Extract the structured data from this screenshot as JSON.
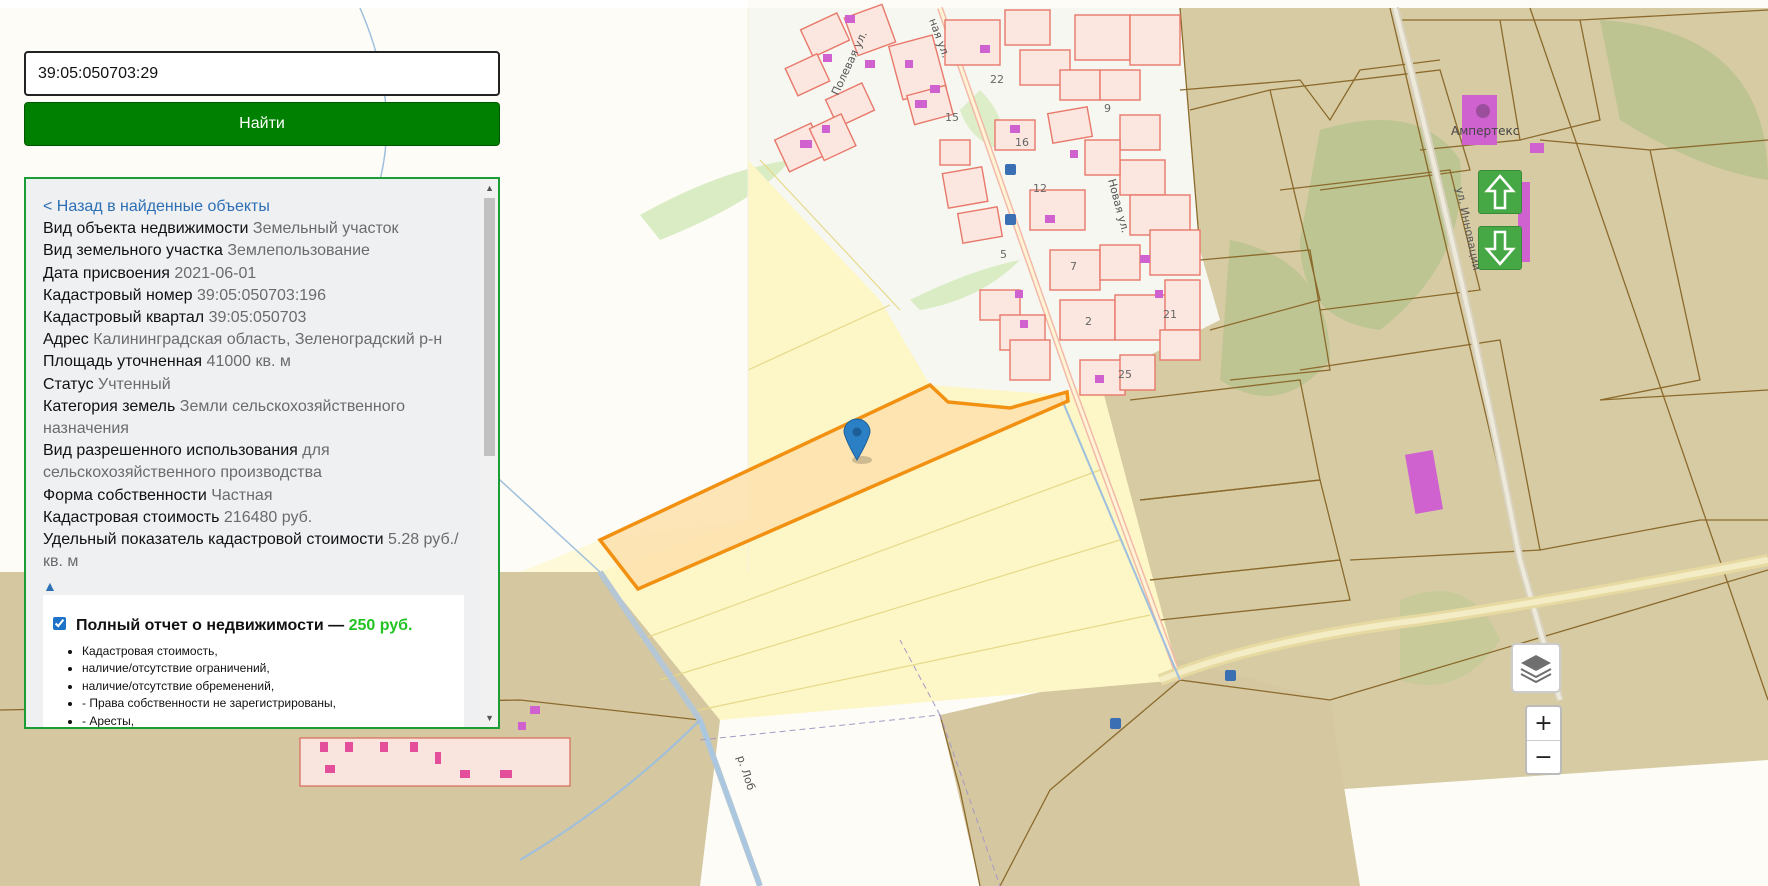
{
  "search": {
    "value": "39:05:050703:29",
    "button_label": "Найти"
  },
  "panel": {
    "back_link": "< Назад в найденные объекты",
    "fields": [
      {
        "label": "Вид объекта недвижимости",
        "value": "Земельный участок"
      },
      {
        "label": "Вид земельного участка",
        "value": "Землепользование"
      },
      {
        "label": "Дата присвоения",
        "value": "2021-06-01"
      },
      {
        "label": "Кадастровый номер",
        "value": "39:05:050703:196"
      },
      {
        "label": "Кадастровый квартал",
        "value": "39:05:050703"
      },
      {
        "label": "Адрес",
        "value": "Калининградская область, Зеленоградский р-н"
      },
      {
        "label": "Площадь уточненная",
        "value": "41000 кв. м"
      },
      {
        "label": "Статус",
        "value": "Учтенный"
      },
      {
        "label": "Категория земель",
        "value": "Земли сельскохозяйственного назначения"
      },
      {
        "label": "Вид разрешенного использования",
        "value": "для сельскохозяйственного производства"
      },
      {
        "label": "Форма собственности",
        "value": "Частная"
      },
      {
        "label": "Кадастровая стоимость",
        "value": "216480 руб."
      },
      {
        "label": "Удельный показатель кадастровой стоимости",
        "value": "5.28 руб./кв. м"
      }
    ],
    "collapse_symbol": "▲",
    "report": {
      "checked": true,
      "title": "Полный отчет о недвижимости —",
      "price": "250 руб.",
      "items": [
        "Кадастровая стоимость,",
        "наличие/отсутствие ограничений,",
        "наличие/отсутствие обременений,",
        "- Права собственности не зарегистрированы,",
        "- Аресты,"
      ]
    }
  },
  "map": {
    "street_labels": [
      "Полевая ул.",
      "ная ул.",
      "Новая ул.",
      "ул. Инновации",
      "р. Лоб"
    ],
    "house_numbers": [
      "22",
      "15",
      "16",
      "12",
      "5",
      "2",
      "21",
      "25",
      "9",
      "7"
    ],
    "poi_label": "Ампертекс",
    "colors": {
      "parcel_highlight": "#f29111",
      "parcel_fill": "#fde3b5",
      "land_tan": "#d5c7a0",
      "field_yellow": "#fdf6c8",
      "building_red": "#e87b6c",
      "building_pink": "#c855c8",
      "marker_blue": "#2a7fc5"
    }
  },
  "controls": {
    "arrow_up_icon": "arrow-up-icon",
    "arrow_down_icon": "arrow-down-icon",
    "layers_icon": "layers-icon",
    "zoom_in_label": "+",
    "zoom_out_label": "−"
  }
}
